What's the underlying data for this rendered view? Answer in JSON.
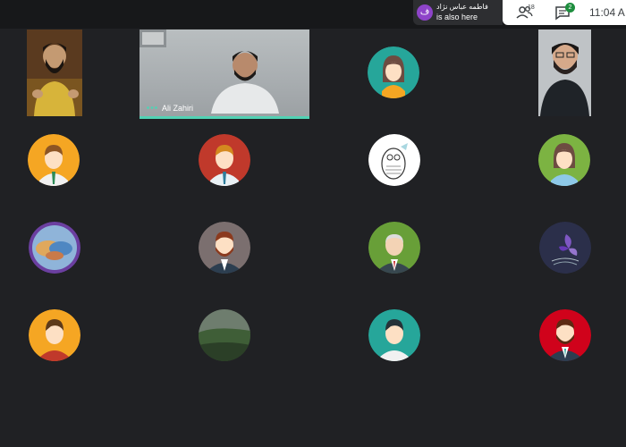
{
  "notification": {
    "avatar_letter": "ف",
    "name": "فاطمه عباس نژاد",
    "message": "is also here"
  },
  "controls": {
    "people_count": "18",
    "chat_badge": "2",
    "time": "11:04 A"
  },
  "video": {
    "participant_name": "Ali Zahiri"
  },
  "colors": {
    "background": "#202124",
    "speaking_indicator": "#52d2b4",
    "badge_green": "#1e8e3e"
  },
  "participants": [
    {
      "icon": "photo-bearded-man-speaking"
    },
    {
      "icon": "live-video"
    },
    {
      "icon": "woman-avatar-teal"
    },
    {
      "icon": "photo-man-glasses"
    },
    {
      "icon": "man-avatar-orange"
    },
    {
      "icon": "man-avatar-red"
    },
    {
      "icon": "penguin-sketch"
    },
    {
      "icon": "woman-avatar-green"
    },
    {
      "icon": "clay-hands-photo"
    },
    {
      "icon": "bearded-man-avatar-gray"
    },
    {
      "icon": "older-man-avatar-green"
    },
    {
      "icon": "purple-flower-photo"
    },
    {
      "icon": "man-avatar-orange"
    },
    {
      "icon": "landscape-photo"
    },
    {
      "icon": "man-avatar-teal"
    },
    {
      "icon": "bearded-man-avatar-red"
    }
  ]
}
